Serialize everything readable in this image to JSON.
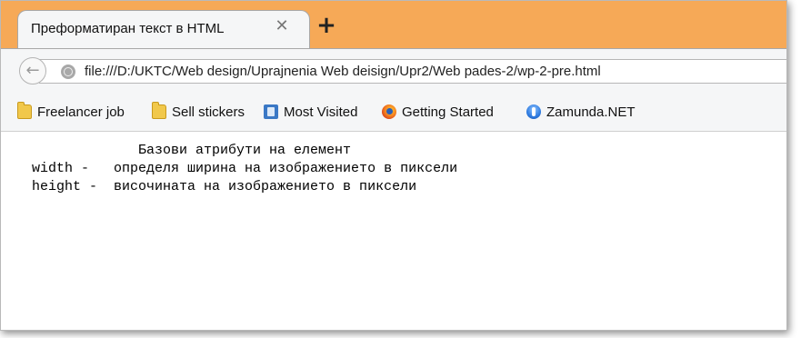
{
  "tab": {
    "title": "Преформатиран текст в HTML",
    "close_glyph": "✕",
    "new_tab_glyph": "+"
  },
  "navbar": {
    "back_glyph": "←",
    "url": "file:///D:/UKTC/Web design/Uprajnenia Web deisign/Upr2/Web pades-2/wp-2-pre.html"
  },
  "bookmarks": [
    {
      "label": "Freelancer job",
      "icon": "folder-icon"
    },
    {
      "label": "Sell stickers",
      "icon": "folder-icon"
    },
    {
      "label": "Most Visited",
      "icon": "most-visited-icon"
    },
    {
      "label": "Getting Started",
      "icon": "firefox-icon"
    },
    {
      "label": "Zamunda.NET",
      "icon": "zamunda-icon"
    }
  ],
  "content": {
    "pre_lines": [
      "               Базови атрибути на елемент",
      "  width -   определя ширина на изображението в пиксели",
      "  height -  височината на изображението в пиксели"
    ]
  },
  "colors": {
    "tabstrip": "#f6a957",
    "toolbar": "#f5f6f7"
  }
}
